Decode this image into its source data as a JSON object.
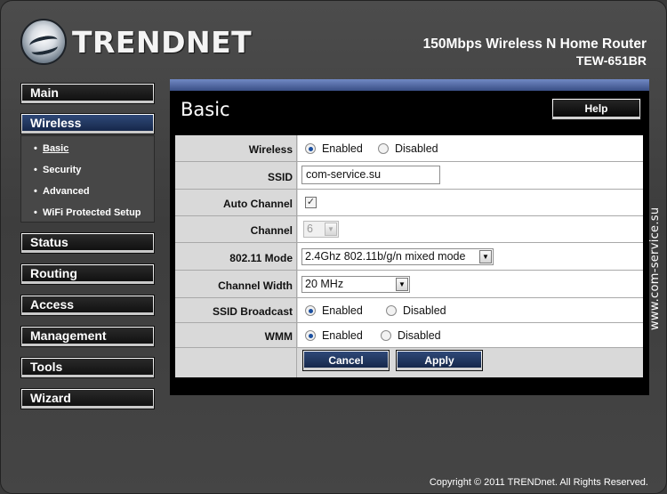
{
  "header": {
    "brand": "TRENDNET",
    "product_name": "150Mbps Wireless N Home Router",
    "model": "TEW-651BR"
  },
  "sidebar": {
    "items": [
      {
        "label": "Main"
      },
      {
        "label": "Wireless",
        "active": true
      },
      {
        "label": "Status"
      },
      {
        "label": "Routing"
      },
      {
        "label": "Access"
      },
      {
        "label": "Management"
      },
      {
        "label": "Tools"
      },
      {
        "label": "Wizard"
      }
    ],
    "wireless_sub": [
      {
        "label": "Basic",
        "current": true
      },
      {
        "label": "Security"
      },
      {
        "label": "Advanced"
      },
      {
        "label": "WiFi Protected Setup"
      }
    ],
    "bullet": "•"
  },
  "content": {
    "title": "Basic",
    "help_label": "Help",
    "form": {
      "wireless": {
        "label": "Wireless",
        "options": [
          "Enabled",
          "Disabled"
        ],
        "selected": "Enabled"
      },
      "ssid": {
        "label": "SSID",
        "value": "com-service.su"
      },
      "auto_channel": {
        "label": "Auto Channel",
        "checked": true,
        "check_mark": "✓"
      },
      "channel": {
        "label": "Channel",
        "value": "6"
      },
      "mode": {
        "label": "802.11 Mode",
        "value": "2.4Ghz 802.11b/g/n mixed mode"
      },
      "channel_width": {
        "label": "Channel Width",
        "value": "20 MHz"
      },
      "ssid_broadcast": {
        "label": "SSID Broadcast",
        "options": [
          "Enabled",
          "Disabled"
        ],
        "selected": "Enabled"
      },
      "wmm": {
        "label": "WMM",
        "options": [
          "Enabled",
          "Disabled"
        ],
        "selected": "Enabled"
      },
      "cancel_label": "Cancel",
      "apply_label": "Apply"
    }
  },
  "dropdown_arrow": "▼",
  "watermark": "www.com-service.su",
  "copyright": "Copyright © 2011 TRENDnet. All Rights Reserved."
}
